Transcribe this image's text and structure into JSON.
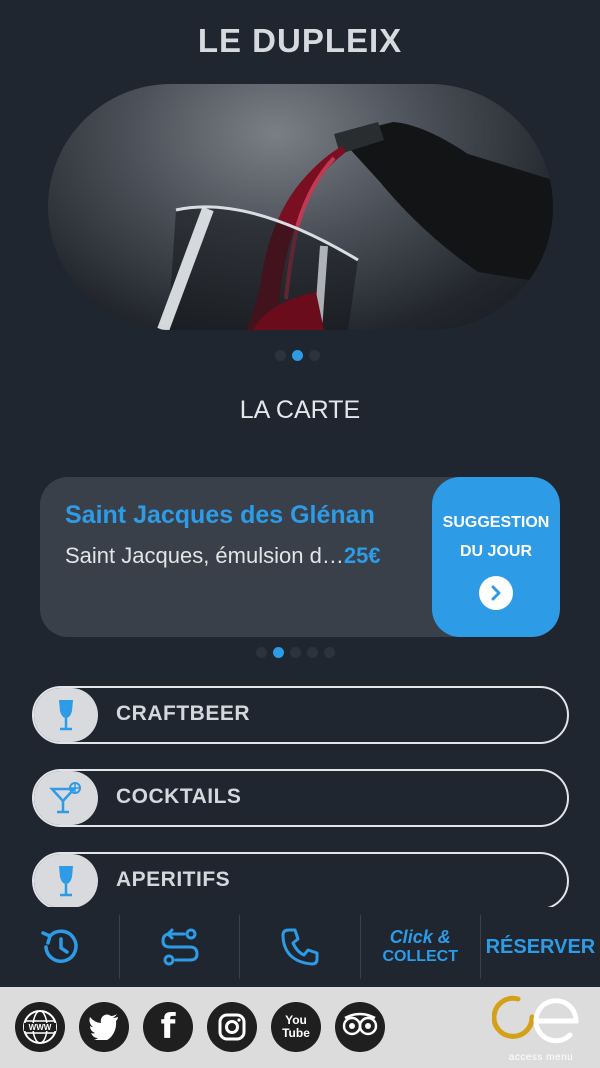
{
  "header": {
    "title": "LE DUPLEIX"
  },
  "hero": {
    "image": "red-wine-pouring-into-glass",
    "carousel": {
      "count": 3,
      "active": 1
    }
  },
  "menu": {
    "section_title": "LA CARTE"
  },
  "suggestion": {
    "name": "Saint Jacques des Glénan",
    "description": "Saint Jacques, émulsion d…",
    "price": "25€",
    "tag_line1": "SUGGESTION",
    "tag_line2": "DU JOUR",
    "arrow_icon": "chevron-right-icon",
    "carousel": {
      "count": 5,
      "active": 1
    }
  },
  "categories": [
    {
      "label": "CRAFTBEER",
      "icon": "wine-glass-icon"
    },
    {
      "label": "COCKTAILS",
      "icon": "cocktail-icon"
    },
    {
      "label": "APERITIFS",
      "icon": "wine-glass-icon"
    }
  ],
  "actions": {
    "hours_icon": "history-clock-icon",
    "directions_icon": "route-icon",
    "phone_icon": "phone-icon",
    "click_collect_line1": "Click &",
    "click_collect_line2": "COLLECT",
    "reserve_label": "RÉSERVER"
  },
  "footer": {
    "social": [
      {
        "name": "website",
        "text": "WWW"
      },
      {
        "name": "twitter",
        "text": ""
      },
      {
        "name": "facebook",
        "text": "f"
      },
      {
        "name": "instagram",
        "text": ""
      },
      {
        "name": "youtube",
        "text": "You Tube"
      },
      {
        "name": "tripadvisor",
        "text": ""
      }
    ],
    "brand": "access menu"
  },
  "colors": {
    "background": "#1f2630",
    "accent": "#2d9be6",
    "card": "#3a4049",
    "footer": "#dcdcdc"
  }
}
